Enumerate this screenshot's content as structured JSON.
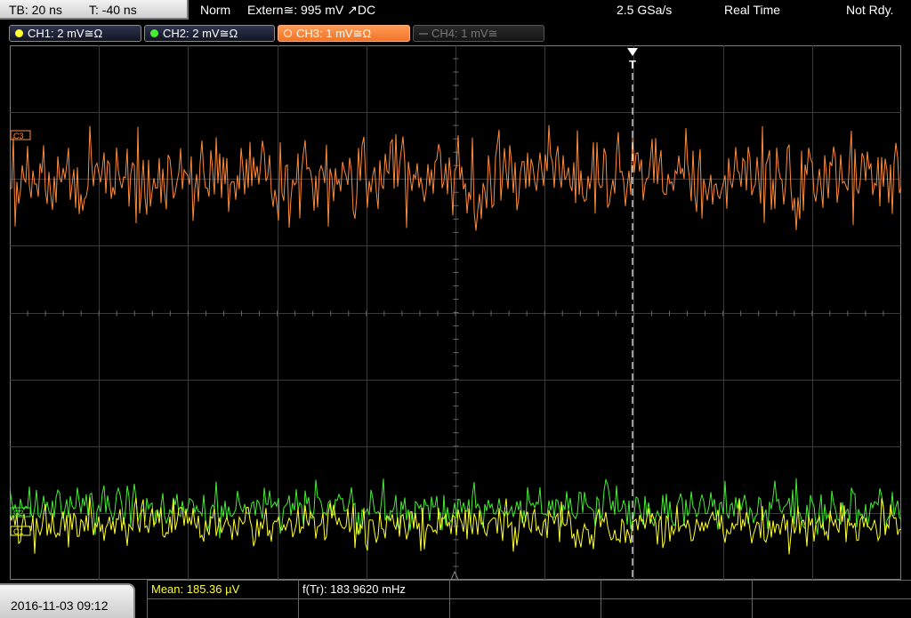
{
  "status": {
    "timebase": "TB: 20 ns",
    "trigger_time": "T: -40 ns",
    "mode": "Norm",
    "trigger_source": "Extern≅: 995 mV ↗DC",
    "sample_rate": "2.5 GSa/s",
    "acq_mode": "Real Time",
    "state": "Not Rdy."
  },
  "channels": [
    {
      "label": "CH1: 2 mV≅Ω",
      "color": "#ffff33",
      "state": "on"
    },
    {
      "label": "CH2: 2 mV≅Ω",
      "color": "#44ee33",
      "state": "on"
    },
    {
      "label": "CH3: 1 mV≅Ω",
      "color": "#ff8a3c",
      "state": "active"
    },
    {
      "label": "CH4: 1 mV≅",
      "color": "#666666",
      "state": "off"
    }
  ],
  "markers": {
    "trigger": "T",
    "ch3": "C3",
    "ch2": "C2",
    "ch1": "C1"
  },
  "measurements": {
    "mean": "Mean: 185.36 µV",
    "freq": "f(Tr): 183.9620 mHz"
  },
  "timestamp": "2016-11-03 09:12",
  "colors": {
    "ch1": "#ffff33",
    "ch2": "#44ee33",
    "ch3": "#ff8a3c",
    "mean_text": "#ffff33"
  }
}
